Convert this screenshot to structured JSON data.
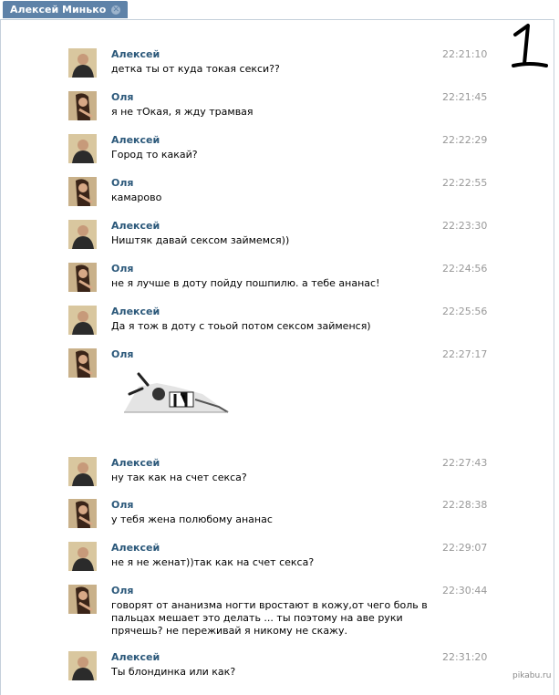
{
  "tab": {
    "title": "Алексей Минько"
  },
  "handwritten_mark": "1",
  "messages": [
    {
      "author": "Алексей",
      "time": "22:21:10",
      "text": "детка ты от куда токая секси??"
    },
    {
      "author": "Оля",
      "time": "22:21:45",
      "text": "я не тОкая, я жду трамвая"
    },
    {
      "author": "Алексей",
      "time": "22:22:29",
      "text": "Город то какай?"
    },
    {
      "author": "Оля",
      "time": "22:22:55",
      "text": "камарово"
    },
    {
      "author": "Алексей",
      "time": "22:23:30",
      "text": "Ништяк давай сексом займемся))"
    },
    {
      "author": "Оля",
      "time": "22:24:56",
      "text": "не я лучше в доту пойду пошпилю. а тебе ананас!"
    },
    {
      "author": "Алексей",
      "time": "22:25:56",
      "text": "Да я тож в доту с тоьой потом сексом займенся)"
    },
    {
      "author": "Оля",
      "time": "22:27:17",
      "text": ""
    },
    {
      "author": "Алексей",
      "time": "22:27:43",
      "text": "ну так как на счет секса?"
    },
    {
      "author": "Оля",
      "time": "22:28:38",
      "text": "у тебя жена полюбому ананас"
    },
    {
      "author": "Алексей",
      "time": "22:29:07",
      "text": "не я не женат))так как на счет секса?"
    },
    {
      "author": "Оля",
      "time": "22:30:44",
      "text": "говорят от ананизма ногти вростают в кожу,от чего боль в пальцах мешает это делать ... ты поэтому на аве руки прячешь? не переживай я никому не скажу."
    },
    {
      "author": "Алексей",
      "time": "22:31:20",
      "text": "Ты блондинка или как?"
    }
  ],
  "watermark": "pikabu.ru"
}
